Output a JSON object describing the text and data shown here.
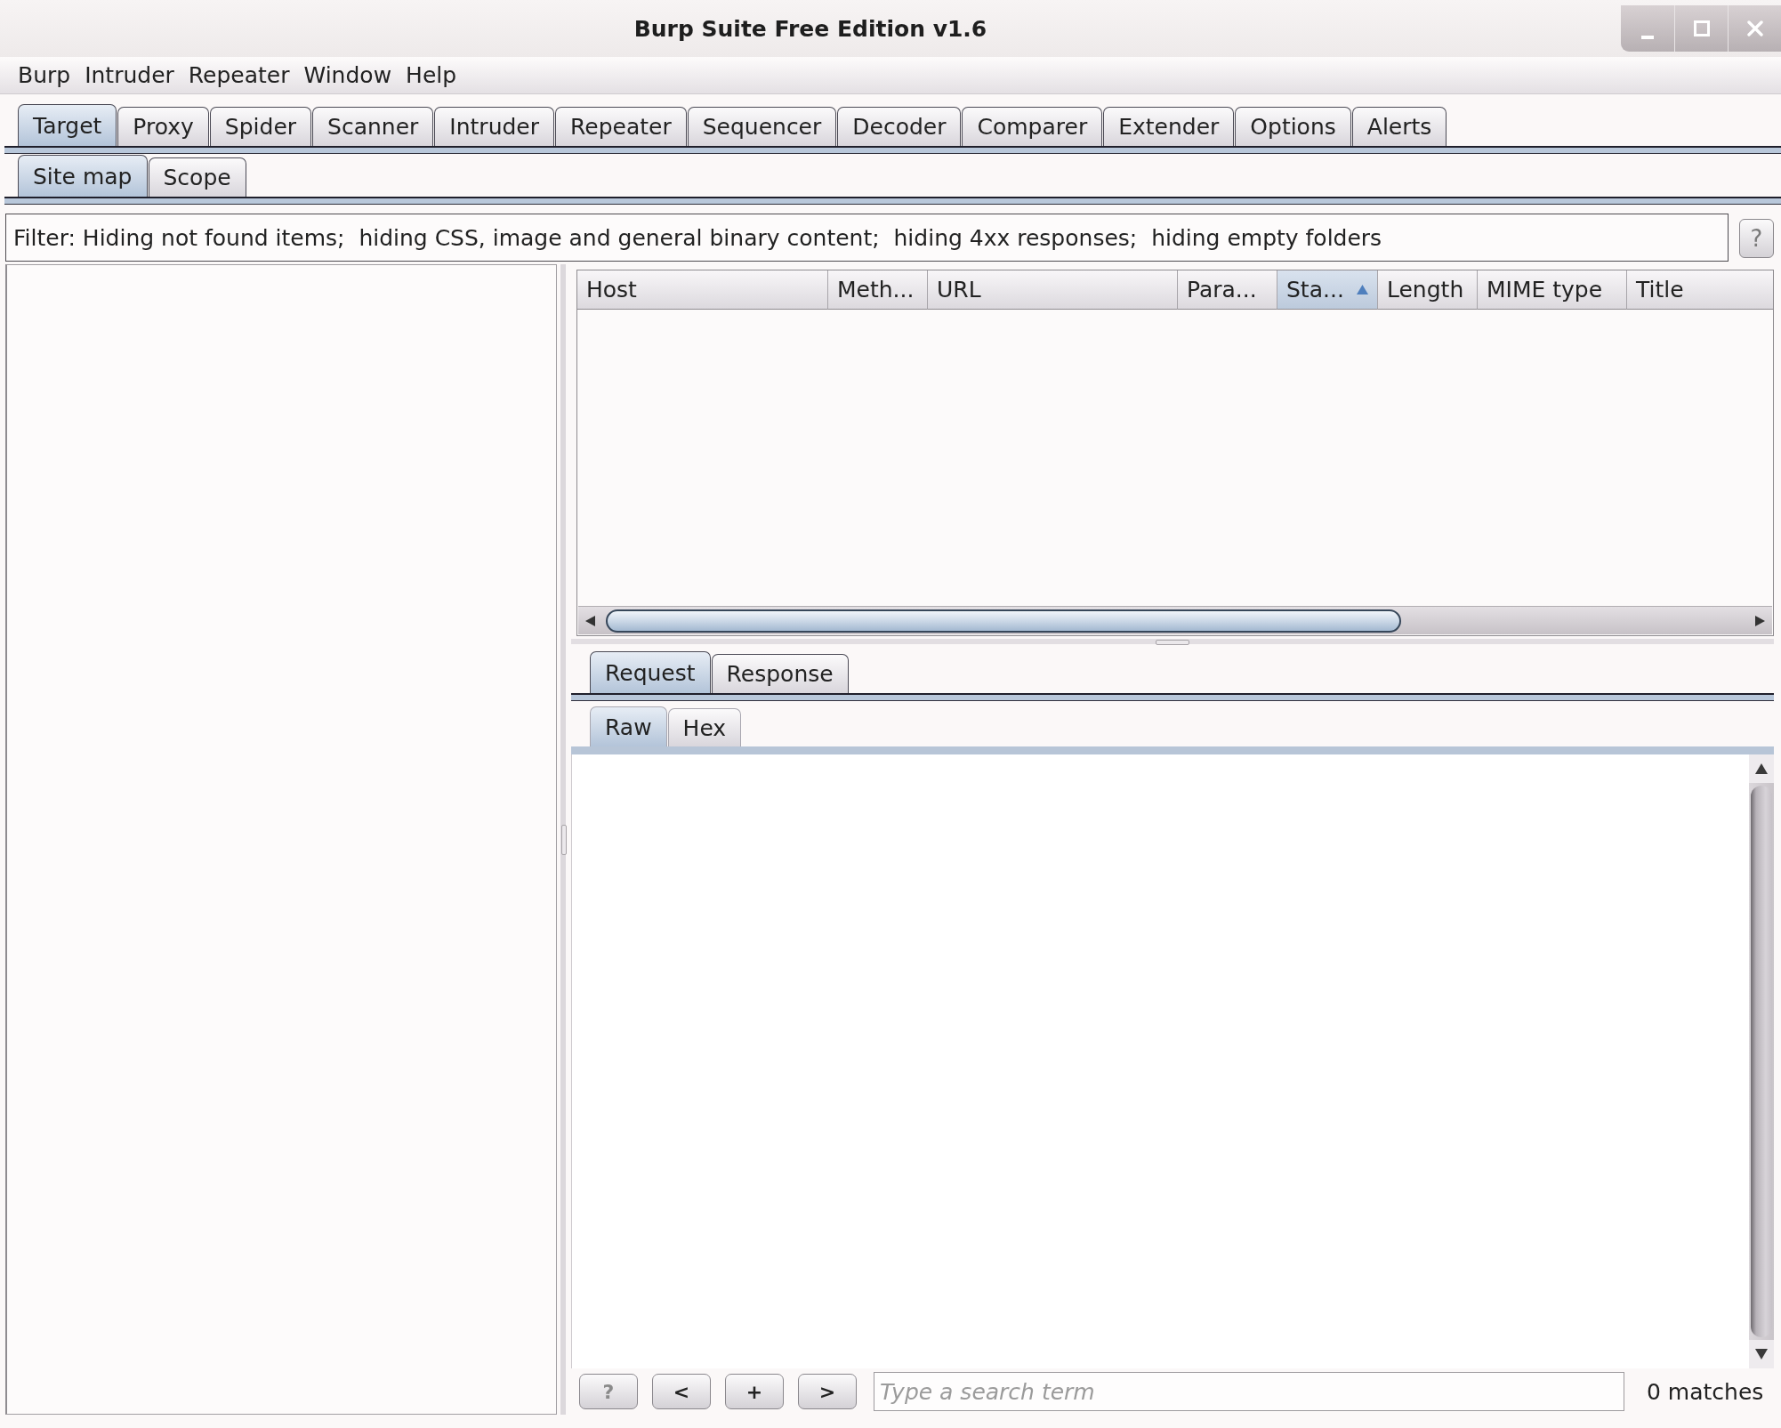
{
  "window": {
    "title": "Burp Suite Free Edition v1.6"
  },
  "menu_bar": [
    "Burp",
    "Intruder",
    "Repeater",
    "Window",
    "Help"
  ],
  "main_tabs": [
    {
      "label": "Target",
      "selected": true
    },
    {
      "label": "Proxy",
      "selected": false
    },
    {
      "label": "Spider",
      "selected": false
    },
    {
      "label": "Scanner",
      "selected": false
    },
    {
      "label": "Intruder",
      "selected": false
    },
    {
      "label": "Repeater",
      "selected": false
    },
    {
      "label": "Sequencer",
      "selected": false
    },
    {
      "label": "Decoder",
      "selected": false
    },
    {
      "label": "Comparer",
      "selected": false
    },
    {
      "label": "Extender",
      "selected": false
    },
    {
      "label": "Options",
      "selected": false
    },
    {
      "label": "Alerts",
      "selected": false
    }
  ],
  "sub_tabs": [
    {
      "label": "Site map",
      "selected": true
    },
    {
      "label": "Scope",
      "selected": false
    }
  ],
  "filter": {
    "summary": "Filter: Hiding not found items;  hiding CSS, image and general binary content;  hiding 4xx responses;  hiding empty folders",
    "help_button": "?"
  },
  "table": {
    "columns": [
      {
        "label": "Host",
        "sorted": false
      },
      {
        "label": "Meth...",
        "sorted": false
      },
      {
        "label": "URL",
        "sorted": false
      },
      {
        "label": "Para...",
        "sorted": false
      },
      {
        "label": "Sta...",
        "sorted": true
      },
      {
        "label": "Length",
        "sorted": false
      },
      {
        "label": "MIME type",
        "sorted": false
      },
      {
        "label": "Title",
        "sorted": false
      }
    ]
  },
  "message_editor": {
    "tabs": [
      {
        "label": "Request",
        "selected": true
      },
      {
        "label": "Response",
        "selected": false
      }
    ],
    "view_tabs": [
      {
        "label": "Raw",
        "selected": true
      },
      {
        "label": "Hex",
        "selected": false
      }
    ],
    "search": {
      "buttons": [
        "?",
        "<",
        "+",
        ">"
      ],
      "placeholder": "Type a search term",
      "matches": "0 matches"
    }
  }
}
